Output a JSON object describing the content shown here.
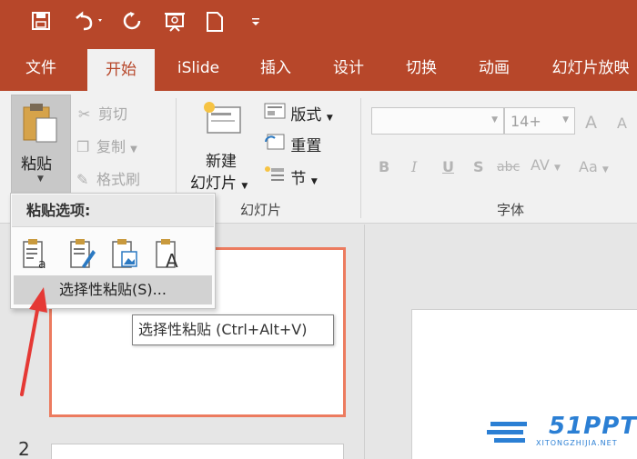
{
  "qat": {
    "save_icon": "save-icon",
    "undo_icon": "undo-icon",
    "redo_icon": "redo-icon",
    "present_icon": "present-icon",
    "new_icon": "new-file-icon",
    "customize_icon": "customize-icon"
  },
  "tabs": [
    "文件",
    "开始",
    "iSlide",
    "插入",
    "设计",
    "切换",
    "动画",
    "幻灯片放映"
  ],
  "active_tab": "开始",
  "clipboard": {
    "paste_label": "粘贴",
    "cut_label": "剪切",
    "copy_label": "复制",
    "format_painter_label": "格式刷"
  },
  "slides_group": {
    "new_slide_label_1": "新建",
    "new_slide_label_2": "幻灯片",
    "layout_label": "版式",
    "reset_label": "重置",
    "section_label": "节",
    "group_label": "幻灯片"
  },
  "font_group": {
    "font_name_value": "",
    "font_size_value": "14+",
    "grow_font": "A",
    "shrink_font": "A",
    "bold": "B",
    "italic": "I",
    "underline": "U",
    "shadow": "S",
    "strikethrough": "abc",
    "spacing": "AV",
    "change_case": "Aa",
    "group_label": "字体"
  },
  "paste_dropdown": {
    "header": "粘贴选项:",
    "options": [
      "使用目标主题",
      "保留源格式",
      "图片",
      "只保留文本"
    ],
    "special_item": "选择性粘贴(S)..."
  },
  "tooltip": "选择性粘贴 (Ctrl+Alt+V)",
  "thumbnails": {
    "slide2_number": "2"
  },
  "watermark": {
    "text": "51PPT",
    "sub": "XITONGZHIJIA.NET"
  },
  "colors": {
    "accent": "#b7472a",
    "ribbon_bg": "#f1f1f1",
    "thumb_selected": "#ec7b5f",
    "arrow": "#e53935"
  }
}
